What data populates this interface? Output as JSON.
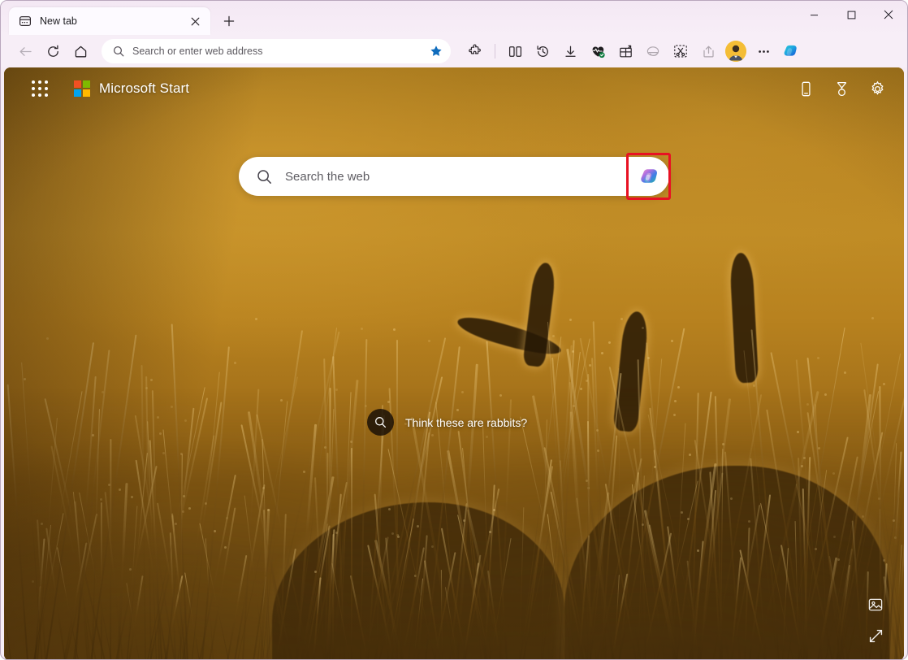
{
  "window": {
    "controls": [
      {
        "name": "minimize",
        "glyph": "minimize-icon"
      },
      {
        "name": "maximize",
        "glyph": "maximize-icon"
      },
      {
        "name": "close",
        "glyph": "close-icon"
      }
    ]
  },
  "tabs": {
    "items": [
      {
        "title": "New tab",
        "favicon": "new-tab-page-icon",
        "active": true,
        "close_label": "Close tab"
      }
    ],
    "new_tab_label": "New tab"
  },
  "toolbar": {
    "back_label": "Back",
    "refresh_label": "Refresh",
    "home_label": "Home",
    "address": {
      "value": "",
      "placeholder": "Search or enter web address",
      "search_icon": "search-icon",
      "favorite_icon": "star-filled-icon",
      "favorite_color": "#0f6cbd"
    },
    "actions": [
      {
        "name": "extensions",
        "icon": "puzzle-icon",
        "label": "Extensions",
        "dim": false
      },
      {
        "name": "split-screen",
        "icon": "split-screen-icon",
        "label": "Split screen",
        "dim": false
      },
      {
        "name": "history",
        "icon": "history-icon",
        "label": "History",
        "dim": false
      },
      {
        "name": "downloads",
        "icon": "download-icon",
        "label": "Downloads",
        "dim": false
      },
      {
        "name": "browser-essentials",
        "icon": "heartbeat-icon",
        "label": "Browser essentials",
        "dim": false
      },
      {
        "name": "collections",
        "icon": "gift-box-icon",
        "label": "Collections",
        "dim": false
      },
      {
        "name": "ie-mode",
        "icon": "internet-explorer-icon",
        "label": "Reload in Internet Explorer mode",
        "dim": true
      },
      {
        "name": "web-capture",
        "icon": "scissors-icon",
        "label": "Screenshot",
        "dim": false
      },
      {
        "name": "share",
        "icon": "share-icon",
        "label": "Share",
        "dim": true
      }
    ],
    "profile_label": "Profile",
    "settings_label": "Settings and more",
    "copilot_label": "Copilot"
  },
  "page": {
    "header": {
      "app_launcher_label": "App launcher",
      "brand": "Microsoft Start",
      "logo": "microsoft-logo",
      "logo_colors": [
        "#f25022",
        "#7fba00",
        "#00a4ef",
        "#ffb900"
      ],
      "actions": [
        {
          "name": "mobile",
          "icon": "phone-icon",
          "label": "Get the mobile app"
        },
        {
          "name": "rewards",
          "icon": "medal-icon",
          "label": "Microsoft Rewards"
        },
        {
          "name": "settings",
          "icon": "gear-icon",
          "label": "Page settings"
        }
      ]
    },
    "search": {
      "placeholder": "Search the web",
      "value": "",
      "search_icon": "search-icon",
      "copilot_button_label": "Copilot",
      "highlight_color": "#e81123"
    },
    "hotspot": {
      "icon": "visual-search-icon",
      "label": "Think these are rabbits?"
    },
    "image_controls": [
      {
        "name": "image-info",
        "icon": "image-info-icon",
        "label": "About this image"
      },
      {
        "name": "expand",
        "icon": "expand-arrows-icon",
        "label": "Expand background"
      }
    ],
    "background": {
      "description": "Backlit hares in tall grass at golden hour",
      "accent": "#b8821f"
    }
  }
}
